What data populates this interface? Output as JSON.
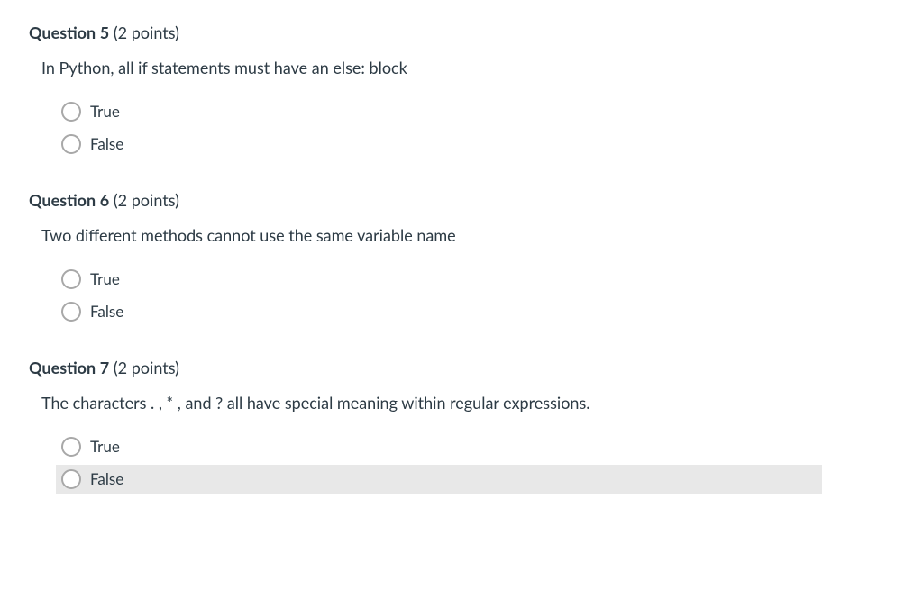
{
  "questions": [
    {
      "label_prefix": "Question",
      "number": "5",
      "points_text": " (2 points)",
      "text": "In Python, all if statements must have an else:  block",
      "options": [
        {
          "label": "True",
          "highlighted": false
        },
        {
          "label": "False",
          "highlighted": false
        }
      ]
    },
    {
      "label_prefix": "Question",
      "number": "6",
      "points_text": " (2 points)",
      "text": "Two different methods cannot use the same variable name",
      "options": [
        {
          "label": "True",
          "highlighted": false
        },
        {
          "label": "False",
          "highlighted": false
        }
      ]
    },
    {
      "label_prefix": "Question",
      "number": "7",
      "points_text": " (2 points)",
      "text": "The characters . , * , and ? all have special meaning within regular expressions.",
      "options": [
        {
          "label": "True",
          "highlighted": false
        },
        {
          "label": "False",
          "highlighted": true
        }
      ]
    }
  ]
}
